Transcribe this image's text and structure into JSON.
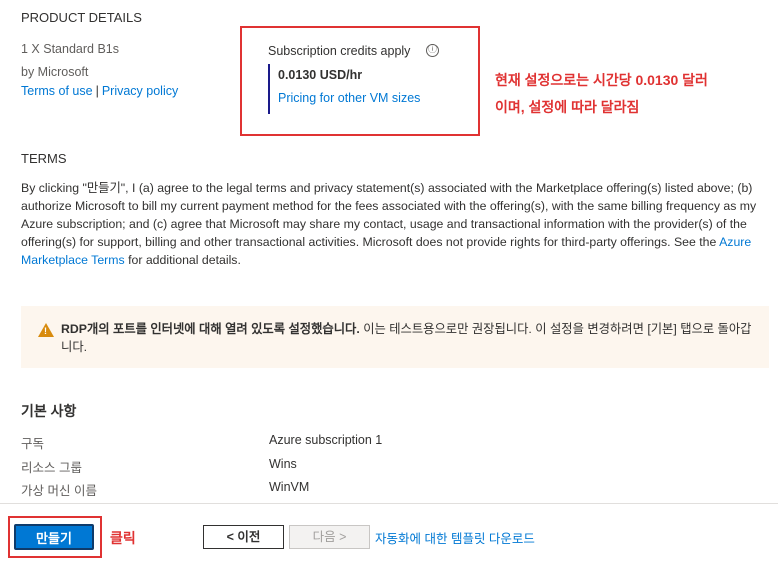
{
  "product": {
    "heading": "PRODUCT DETAILS",
    "name": "1 X Standard B1s",
    "by": "by Microsoft",
    "terms_link": "Terms of use",
    "separator": "|",
    "privacy_link": "Privacy policy"
  },
  "credits": {
    "title": "Subscription credits apply",
    "info_icon": "ⓘ",
    "price": "0.0130 USD/hr",
    "pricing_link": "Pricing for other VM sizes"
  },
  "annotations": {
    "price_note_line1": "현재 설정으로는 시간당 0.0130 달러",
    "price_note_line2": "이며, 설정에 따라 달라짐",
    "click_note": "클릭"
  },
  "terms": {
    "heading": "TERMS",
    "body_before_link": "By clicking \"만들기\", I (a) agree to the legal terms and privacy statement(s) associated with the Marketplace offering(s) listed above; (b) authorize Microsoft to bill my current payment method for the fees associated with the offering(s), with the same billing frequency as my Azure subscription; and (c) agree that Microsoft may share my contact, usage and transactional information with the provider(s) of the offering(s) for support, billing and other transactional activities. Microsoft does not provide rights for third-party offerings. See the ",
    "link": "Azure Marketplace Terms",
    "body_after_link": " for additional details."
  },
  "warning": {
    "icon": "warning-icon",
    "bold_text": "RDP개의 포트를 인터넷에 대해 열려 있도록 설정했습니다.",
    "text": " 이는 테스트용으로만 권장됩니다. 이 설정을 변경하려면 [기본] 탭으로 돌아갑니다."
  },
  "basics": {
    "heading": "기본 사항",
    "rows": [
      {
        "label": "구독",
        "value": "Azure subscription 1"
      },
      {
        "label": "리소스 그룹",
        "value": "Wins"
      },
      {
        "label": "가상 머신 이름",
        "value": "WinVM"
      }
    ]
  },
  "footer": {
    "create_label": "만들기",
    "prev_label": "< 이전",
    "next_label": "다음 >",
    "download_link": "자동화에 대한 템플릿 다운로드"
  },
  "colors": {
    "accent": "#0078d4",
    "annotation_red": "#e03232",
    "warning_bg": "#fdf6ee",
    "warning_icon": "#d88b0e"
  }
}
